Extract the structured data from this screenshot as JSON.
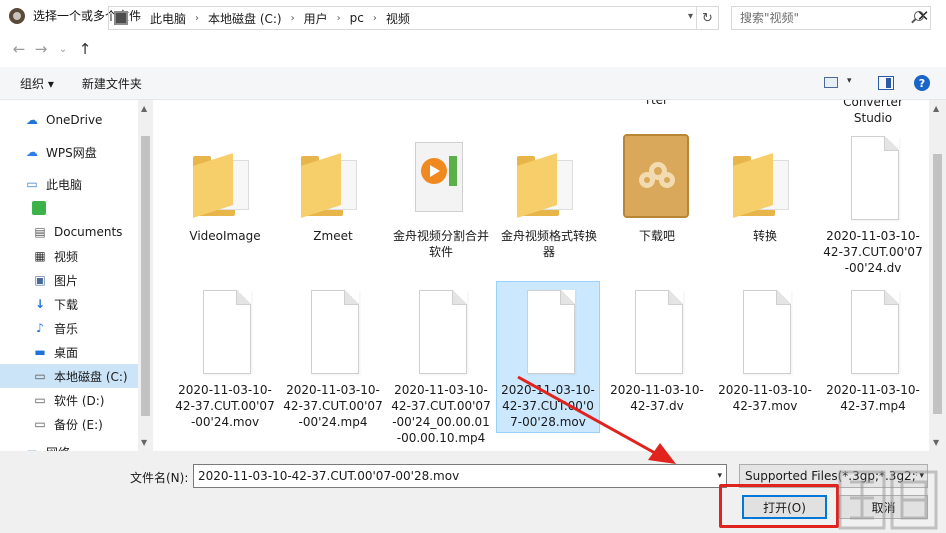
{
  "window": {
    "title": "选择一个或多个文件",
    "close_glyph": "✕"
  },
  "address": {
    "crumbs": [
      "此电脑",
      "本地磁盘 (C:)",
      "用户",
      "pc",
      "视频"
    ],
    "search_placeholder": "搜索\"视频\""
  },
  "toolbar": {
    "organize_label": "组织 ▾",
    "new_folder_label": "新建文件夹",
    "help_label": "?"
  },
  "nav": {
    "items": [
      {
        "label": "OneDrive",
        "icon": "cloud-icon"
      },
      {
        "label": "WPS网盘",
        "icon": "wps-cloud-icon"
      },
      {
        "label": "此电脑",
        "icon": "computer-icon"
      },
      {
        "label": "",
        "icon": "green-app-icon"
      },
      {
        "label": "Documents",
        "icon": "document-icon"
      },
      {
        "label": "视频",
        "icon": "video-icon"
      },
      {
        "label": "图片",
        "icon": "picture-icon"
      },
      {
        "label": "下载",
        "icon": "download-icon"
      },
      {
        "label": "音乐",
        "icon": "music-icon"
      },
      {
        "label": "桌面",
        "icon": "desktop-icon"
      },
      {
        "label": "本地磁盘 (C:)",
        "icon": "drive-icon"
      },
      {
        "label": "软件 (D:)",
        "icon": "drive-icon"
      },
      {
        "label": "备份 (E:)",
        "icon": "drive-icon"
      },
      {
        "label": "网络",
        "icon": "network-icon"
      }
    ],
    "selected_index": 10
  },
  "files": {
    "clipped_top": [
      "rter",
      "Converter\nStudio"
    ],
    "row1": [
      {
        "label": "VideoImage",
        "kind": "folder"
      },
      {
        "label": "Zmeet",
        "kind": "folder"
      },
      {
        "label": "金舟视频分割合并软件",
        "kind": "media"
      },
      {
        "label": "金舟视频格式转换器",
        "kind": "folder"
      },
      {
        "label": "下载吧",
        "kind": "baidu"
      },
      {
        "label": "转换",
        "kind": "folder"
      },
      {
        "label": "2020-11-03-10-42-37.CUT.00'07-00'24.dv",
        "kind": "file"
      }
    ],
    "row2": [
      {
        "label": "2020-11-03-10-42-37.CUT.00'07-00'24.mov",
        "kind": "file"
      },
      {
        "label": "2020-11-03-10-42-37.CUT.00'07-00'24.mp4",
        "kind": "file"
      },
      {
        "label": "2020-11-03-10-42-37.CUT.00'07-00'24_00.00.01-00.00.10.mp4",
        "kind": "file"
      },
      {
        "label": "2020-11-03-10-42-37.CUT.00'07-00'28.mov",
        "kind": "file",
        "selected": true
      },
      {
        "label": "2020-11-03-10-42-37.dv",
        "kind": "file"
      },
      {
        "label": "2020-11-03-10-42-37.mov",
        "kind": "file"
      },
      {
        "label": "2020-11-03-10-42-37.mp4",
        "kind": "file"
      }
    ]
  },
  "bottom": {
    "filename_label": "文件名(N):",
    "filename_value": "2020-11-03-10-42-37.CUT.00'07-00'28.mov",
    "filetype_value": "Supported Files(*.3gp;*.3g2;*",
    "open_label": "打开(O)",
    "cancel_label": "取消"
  },
  "colors": {
    "accent": "#0078d7",
    "selection": "#cce8ff",
    "annotation": "#e0241d"
  }
}
